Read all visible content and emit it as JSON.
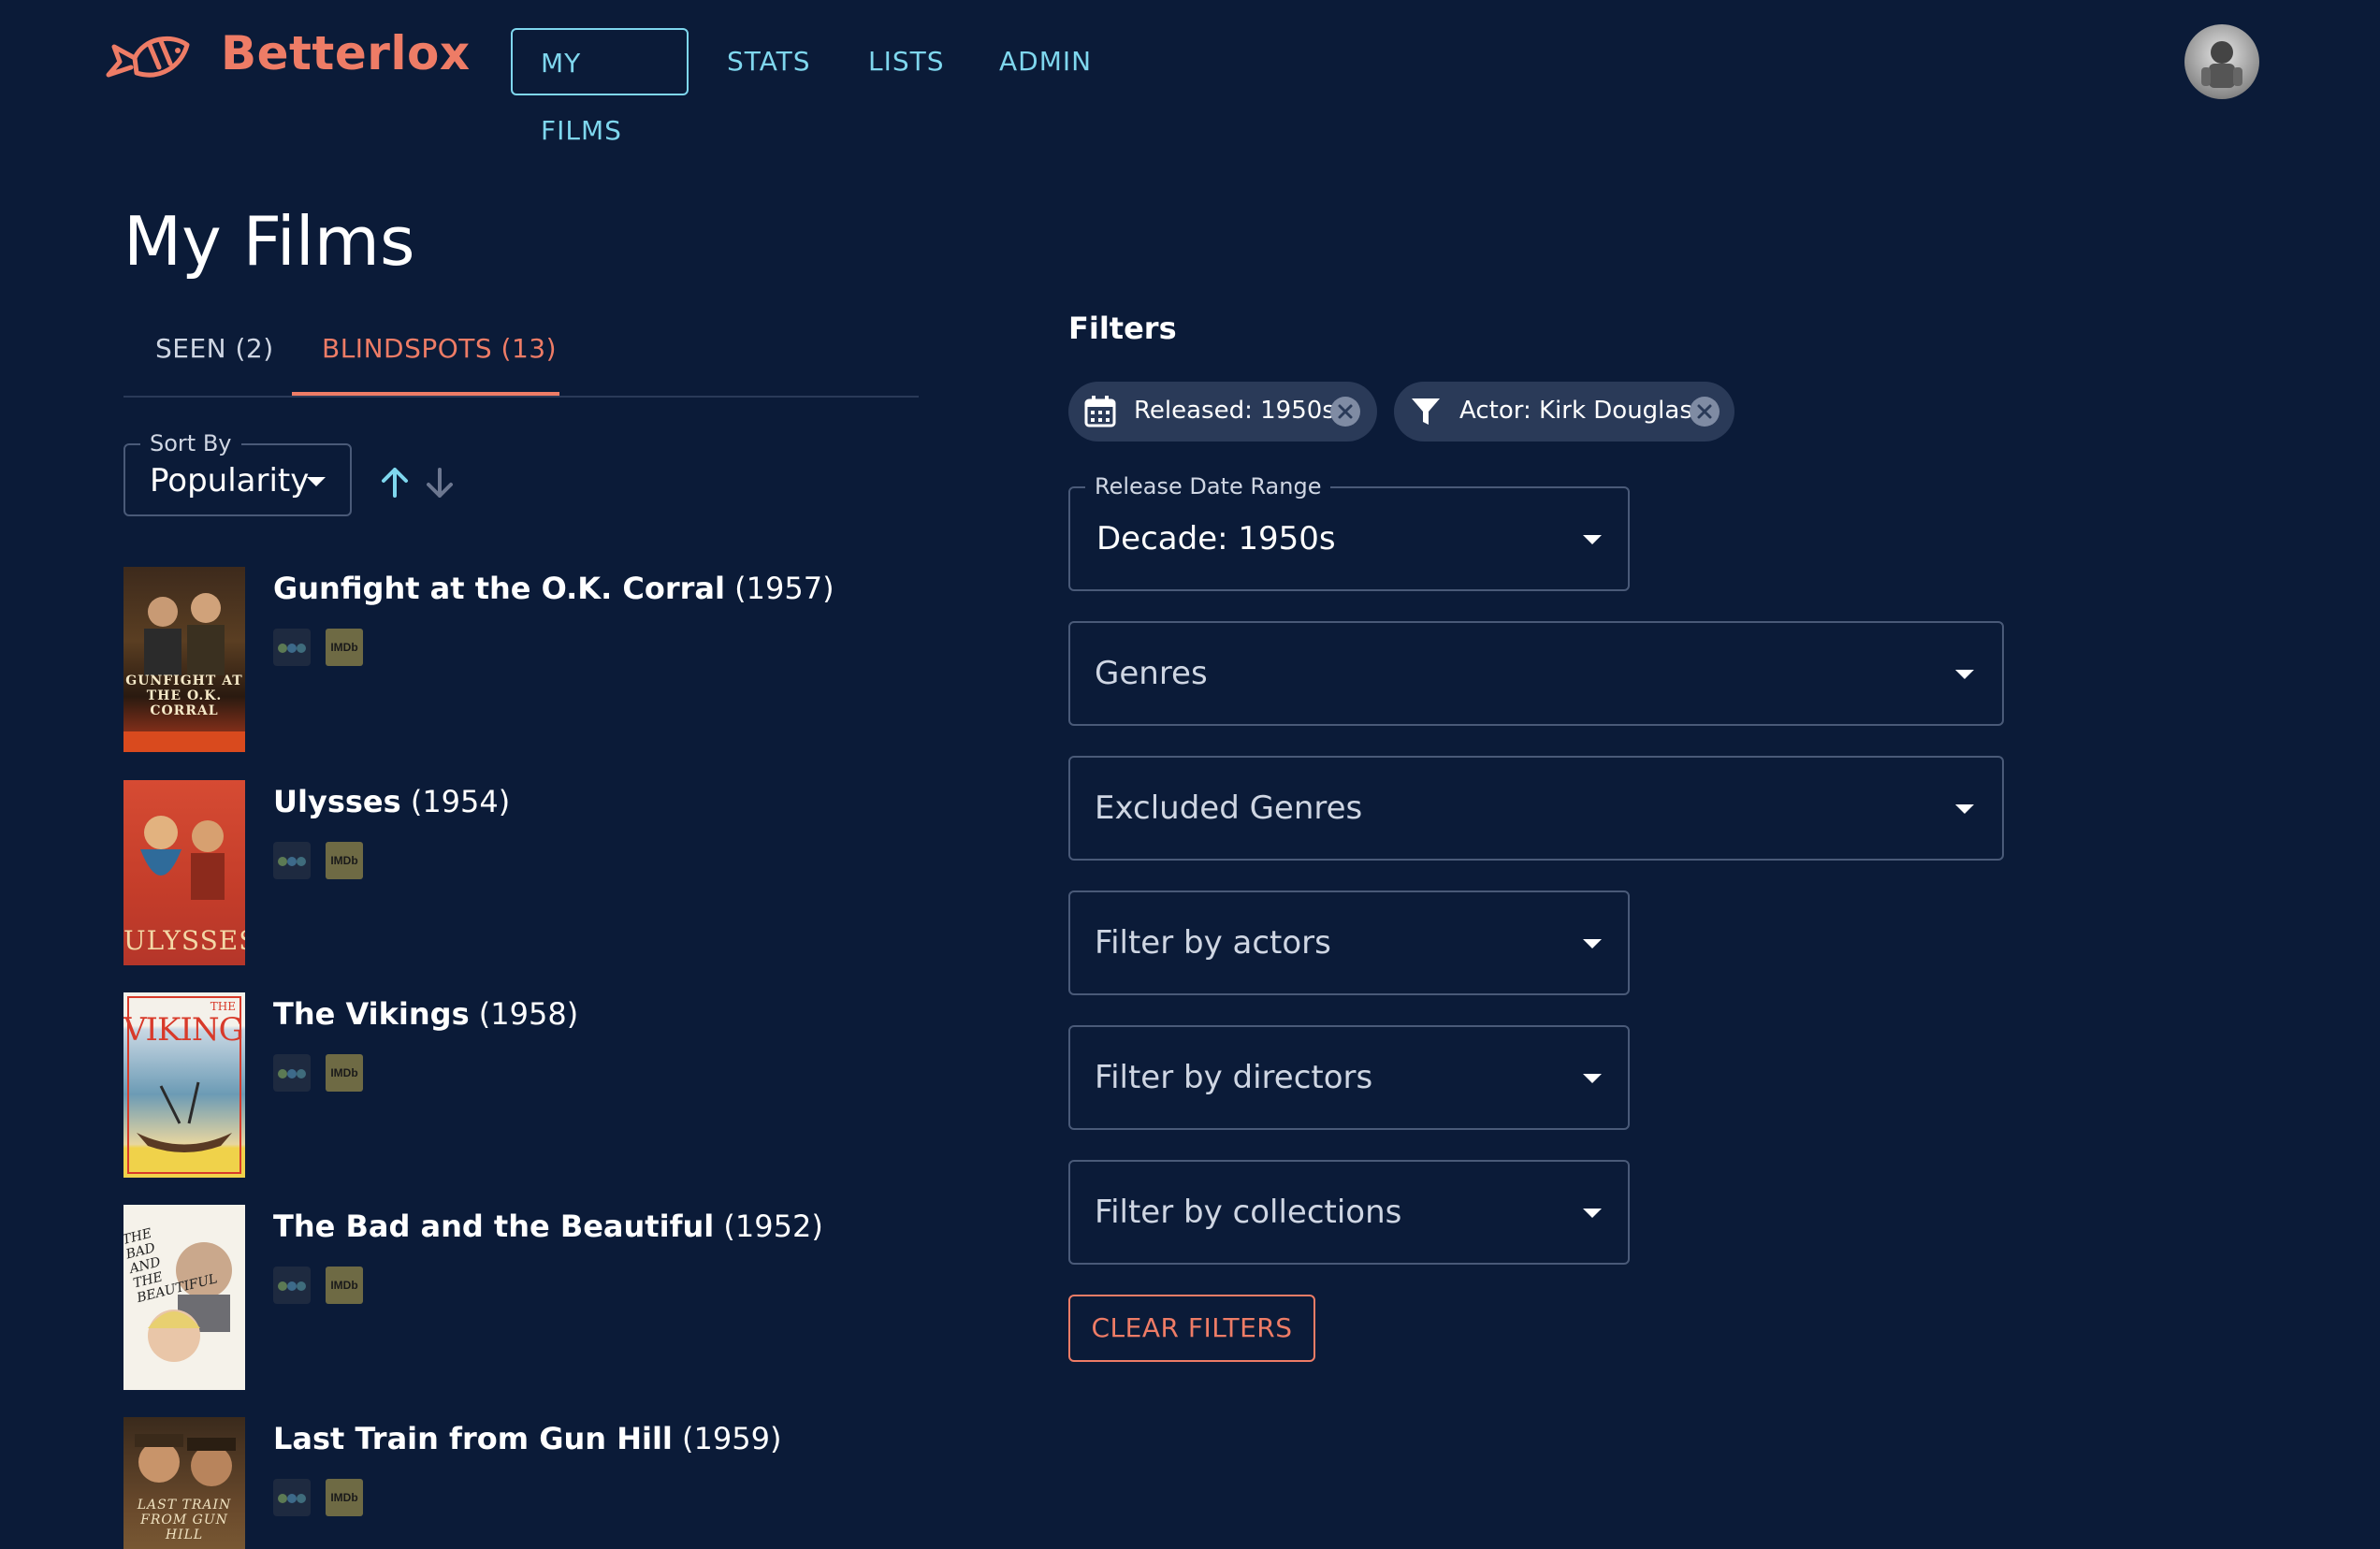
{
  "app": {
    "brand": "Betterlox"
  },
  "nav": {
    "items": [
      "MY FILMS",
      "STATS",
      "LISTS",
      "ADMIN"
    ]
  },
  "page": {
    "title": "My Films"
  },
  "tabs": {
    "seen": "SEEN (2)",
    "blindspots": "BLINDSPOTS (13)"
  },
  "sort": {
    "label": "Sort By",
    "value": "Popularity"
  },
  "films": [
    {
      "title": "Gunfight at the O.K. Corral",
      "year": "(1957)"
    },
    {
      "title": "Ulysses",
      "year": "(1954)"
    },
    {
      "title": "The Vikings",
      "year": "(1958)"
    },
    {
      "title": "The Bad and the Beautiful",
      "year": "(1952)"
    },
    {
      "title": "Last Train from Gun Hill",
      "year": "(1959)"
    }
  ],
  "posters": [
    {
      "text": "GUNFIGHT AT THE O.K. CORRAL"
    },
    {
      "text": "ULYSSES"
    },
    {
      "text": "VIKINGS",
      "small": "THE"
    },
    {
      "text": "THE BAD AND THE BEAUTIFUL"
    },
    {
      "text": "LAST TRAIN FROM GUN HILL"
    }
  ],
  "film_links": {
    "imdb": "IMDb"
  },
  "filters": {
    "heading": "Filters",
    "chips": [
      {
        "label": "Released: 1950s",
        "icon": "calendar-icon"
      },
      {
        "label": "Actor: Kirk Douglas",
        "icon": "filter-funnel-icon"
      }
    ],
    "release_date": {
      "label": "Release Date Range",
      "value": "Decade: 1950s"
    },
    "genres": "Genres",
    "excluded_genres": "Excluded Genres",
    "actors": "Filter by actors",
    "directors": "Filter by directors",
    "collections": "Filter by collections",
    "clear_button": "CLEAR FILTERS"
  },
  "colors": {
    "background": "#0b1b38",
    "accent": "#ee7c66",
    "nav": "#7fd7ee",
    "border": "#4a5a78",
    "chip": "#2a3a58"
  }
}
